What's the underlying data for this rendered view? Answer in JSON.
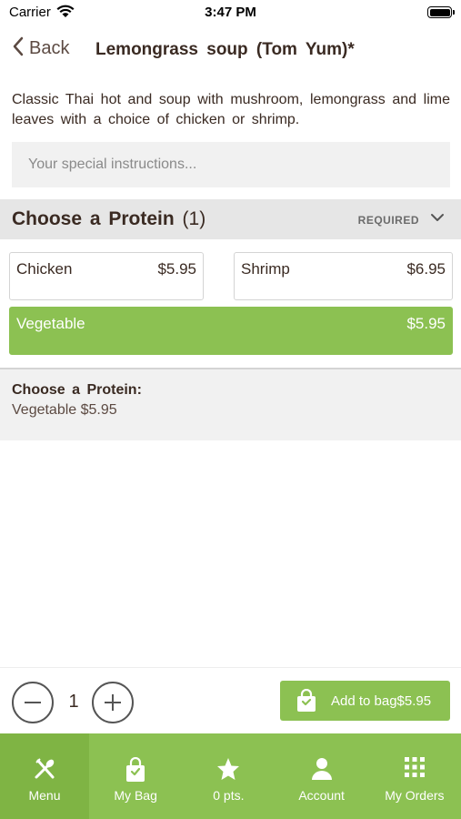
{
  "status_bar": {
    "carrier": "Carrier",
    "time": "3:47 PM"
  },
  "nav": {
    "back_label": "Back",
    "title": "Lemongrass soup (Tom Yum)*"
  },
  "item": {
    "description": "Classic Thai hot and soup with mushroom, lemongrass and lime leaves with a choice of chicken or shrimp.",
    "instructions_placeholder": "Your special instructions..."
  },
  "protein_section": {
    "title": "Choose a Protein",
    "count": "(1)",
    "required_label": "REQUIRED",
    "options": [
      {
        "name": "Chicken",
        "price": "$5.95",
        "selected": false
      },
      {
        "name": "Shrimp",
        "price": "$6.95",
        "selected": false
      },
      {
        "name": "Vegetable",
        "price": "$5.95",
        "selected": true
      }
    ]
  },
  "summary": {
    "title": "Choose a Protein:",
    "value": "Vegetable $5.95"
  },
  "quantity": {
    "value": "1"
  },
  "add_to_bag": {
    "label": "Add to bag$5.95"
  },
  "tabs": [
    {
      "label": "Menu",
      "icon": "utensils-icon",
      "active": true
    },
    {
      "label": "My Bag",
      "icon": "shopping-bag-icon",
      "active": false
    },
    {
      "label": "0 pts.",
      "icon": "star-icon",
      "active": false
    },
    {
      "label": "Account",
      "icon": "person-icon",
      "active": false
    },
    {
      "label": "My Orders",
      "icon": "grid-icon",
      "active": false
    }
  ],
  "colors": {
    "accent": "#8cc152",
    "accent_dark": "#7fb444",
    "text": "#3a2a22",
    "section_bg": "#e6e6e6"
  }
}
